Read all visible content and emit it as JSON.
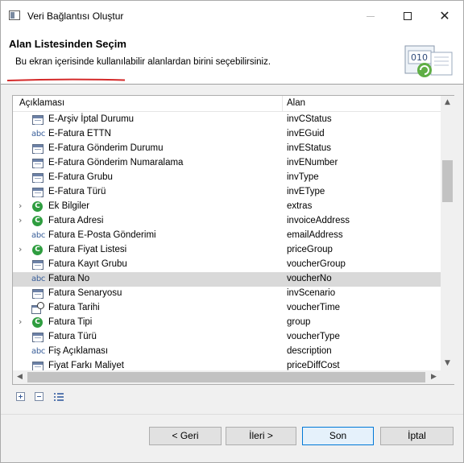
{
  "window": {
    "title": "Veri Bağlantısı Oluştur"
  },
  "banner": {
    "title": "Alan Listesinden Seçim",
    "description": "Bu ekran içerisinde kullanılabilir alanlardan birini seçebilirsiniz.",
    "graphic_text": "010"
  },
  "table": {
    "headers": {
      "description": "Açıklaması",
      "field": "Alan"
    },
    "rows": [
      {
        "label": "E-Arşiv İptal Durumu",
        "field": "invCStatus",
        "icon": "table-icon",
        "expandable": false
      },
      {
        "label": "E-Fatura ETTN",
        "field": "invEGuid",
        "icon": "abc-icon",
        "expandable": false
      },
      {
        "label": "E-Fatura Gönderim Durumu",
        "field": "invEStatus",
        "icon": "table-icon",
        "expandable": false
      },
      {
        "label": "E-Fatura Gönderim Numaralama",
        "field": "invENumber",
        "icon": "table-icon",
        "expandable": false
      },
      {
        "label": "E-Fatura Grubu",
        "field": "invType",
        "icon": "table-icon",
        "expandable": false
      },
      {
        "label": "E-Fatura Türü",
        "field": "invEType",
        "icon": "table-icon",
        "expandable": false
      },
      {
        "label": "Ek Bilgiler",
        "field": "extras",
        "icon": "class-icon",
        "expandable": true
      },
      {
        "label": "Fatura Adresi",
        "field": "invoiceAddress",
        "icon": "class-icon",
        "expandable": true
      },
      {
        "label": "Fatura E-Posta Gönderimi",
        "field": "emailAddress",
        "icon": "abc-icon",
        "expandable": false
      },
      {
        "label": "Fatura Fiyat Listesi",
        "field": "priceGroup",
        "icon": "class-icon",
        "expandable": true
      },
      {
        "label": "Fatura Kayıt Grubu",
        "field": "voucherGroup",
        "icon": "table-icon",
        "expandable": false
      },
      {
        "label": "Fatura No",
        "field": "voucherNo",
        "icon": "abc-icon",
        "expandable": false,
        "selected": true
      },
      {
        "label": "Fatura Senaryosu",
        "field": "invScenario",
        "icon": "table-icon",
        "expandable": false
      },
      {
        "label": "Fatura Tarihi",
        "field": "voucherTime",
        "icon": "date-icon",
        "expandable": false
      },
      {
        "label": "Fatura Tipi",
        "field": "group",
        "icon": "class-icon",
        "expandable": true
      },
      {
        "label": "Fatura Türü",
        "field": "voucherType",
        "icon": "table-icon",
        "expandable": false
      },
      {
        "label": "Fiş Açıklaması",
        "field": "description",
        "icon": "abc-icon",
        "expandable": false
      },
      {
        "label": "Fiyat Farkı Maliyet",
        "field": "priceDiffCost",
        "icon": "table-icon",
        "expandable": false
      }
    ]
  },
  "buttons": {
    "back": "< Geri",
    "next": "İleri >",
    "finish": "Son",
    "cancel": "İptal"
  },
  "colors": {
    "selection": "#d9d9d9",
    "accent_underline": "#d42a2a",
    "default_button_border": "#0078d7",
    "class_icon": "#2e9d3f"
  }
}
